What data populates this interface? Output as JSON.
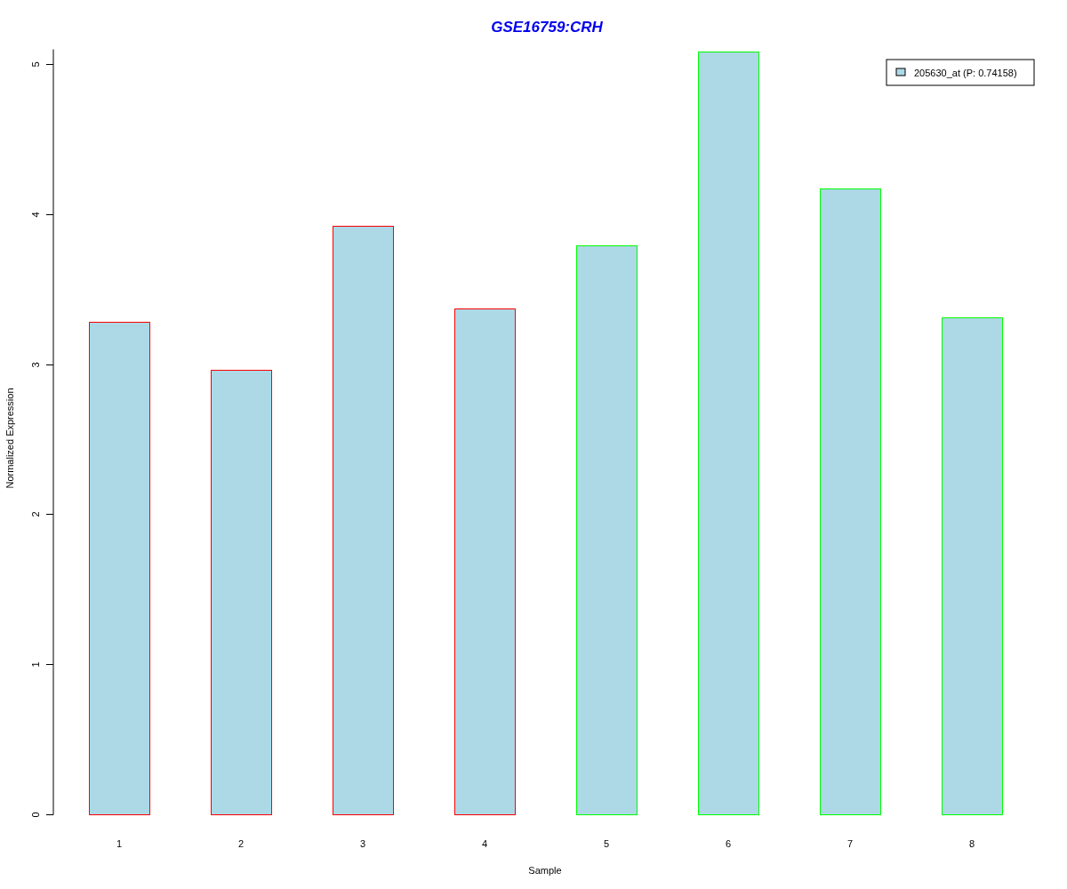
{
  "chart_data": {
    "type": "bar",
    "title": "GSE16759:CRH",
    "xlabel": "Sample",
    "ylabel": "Normalized Expression",
    "categories": [
      "1",
      "2",
      "3",
      "4",
      "5",
      "6",
      "7",
      "8"
    ],
    "series": [
      {
        "name": "205630_at (P: 0.74158)",
        "color": "#add8e6",
        "values": [
          3.28,
          2.96,
          3.92,
          3.37,
          3.79,
          5.08,
          4.17,
          3.31
        ]
      }
    ],
    "ylim": [
      0,
      5.1
    ],
    "yticks": [
      0,
      1,
      2,
      3,
      4,
      5
    ]
  },
  "bar_outlines": [
    {
      "color": "#ff0000"
    },
    {
      "color": "#ff0000"
    },
    {
      "color": "#ff0000"
    },
    {
      "color": "#ff0000"
    },
    {
      "color": "#00ff00"
    },
    {
      "color": "#00ff00"
    },
    {
      "color": "#00ff00"
    },
    {
      "color": "#00ff00"
    }
  ]
}
